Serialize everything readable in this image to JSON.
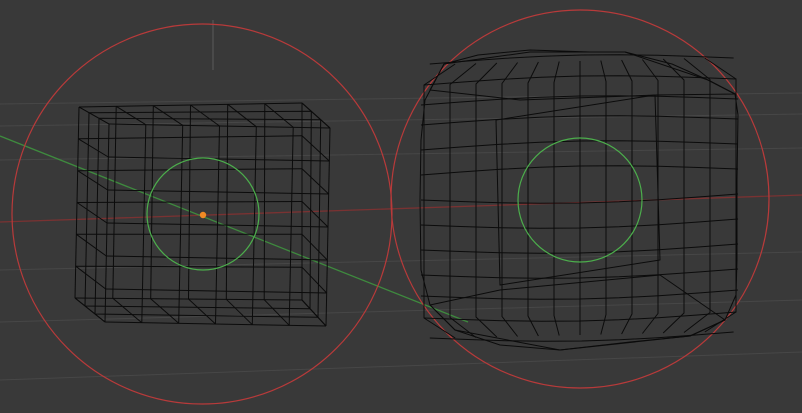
{
  "viewport": {
    "background": "#393939",
    "grid_color": "#474747",
    "axis_x_color": "#7a3232",
    "axis_y_color": "#3e8a3e",
    "z_axis_color": "#5a5a5a",
    "mesh_color": "#0b0b0b",
    "lamp_ring_color": "#b83a3a",
    "object_ring_color": "#4cae4c",
    "origin_color": "#f08a24"
  },
  "objects": [
    {
      "name": "cube-wireframe",
      "subdivisions": 6
    },
    {
      "name": "subdivided-rounded-cube-wireframe",
      "subdivisions": 8
    }
  ],
  "icons": {
    "origin": "origin-dot-icon",
    "x_axis": "x-axis-line-icon",
    "y_axis": "y-axis-line-icon"
  }
}
